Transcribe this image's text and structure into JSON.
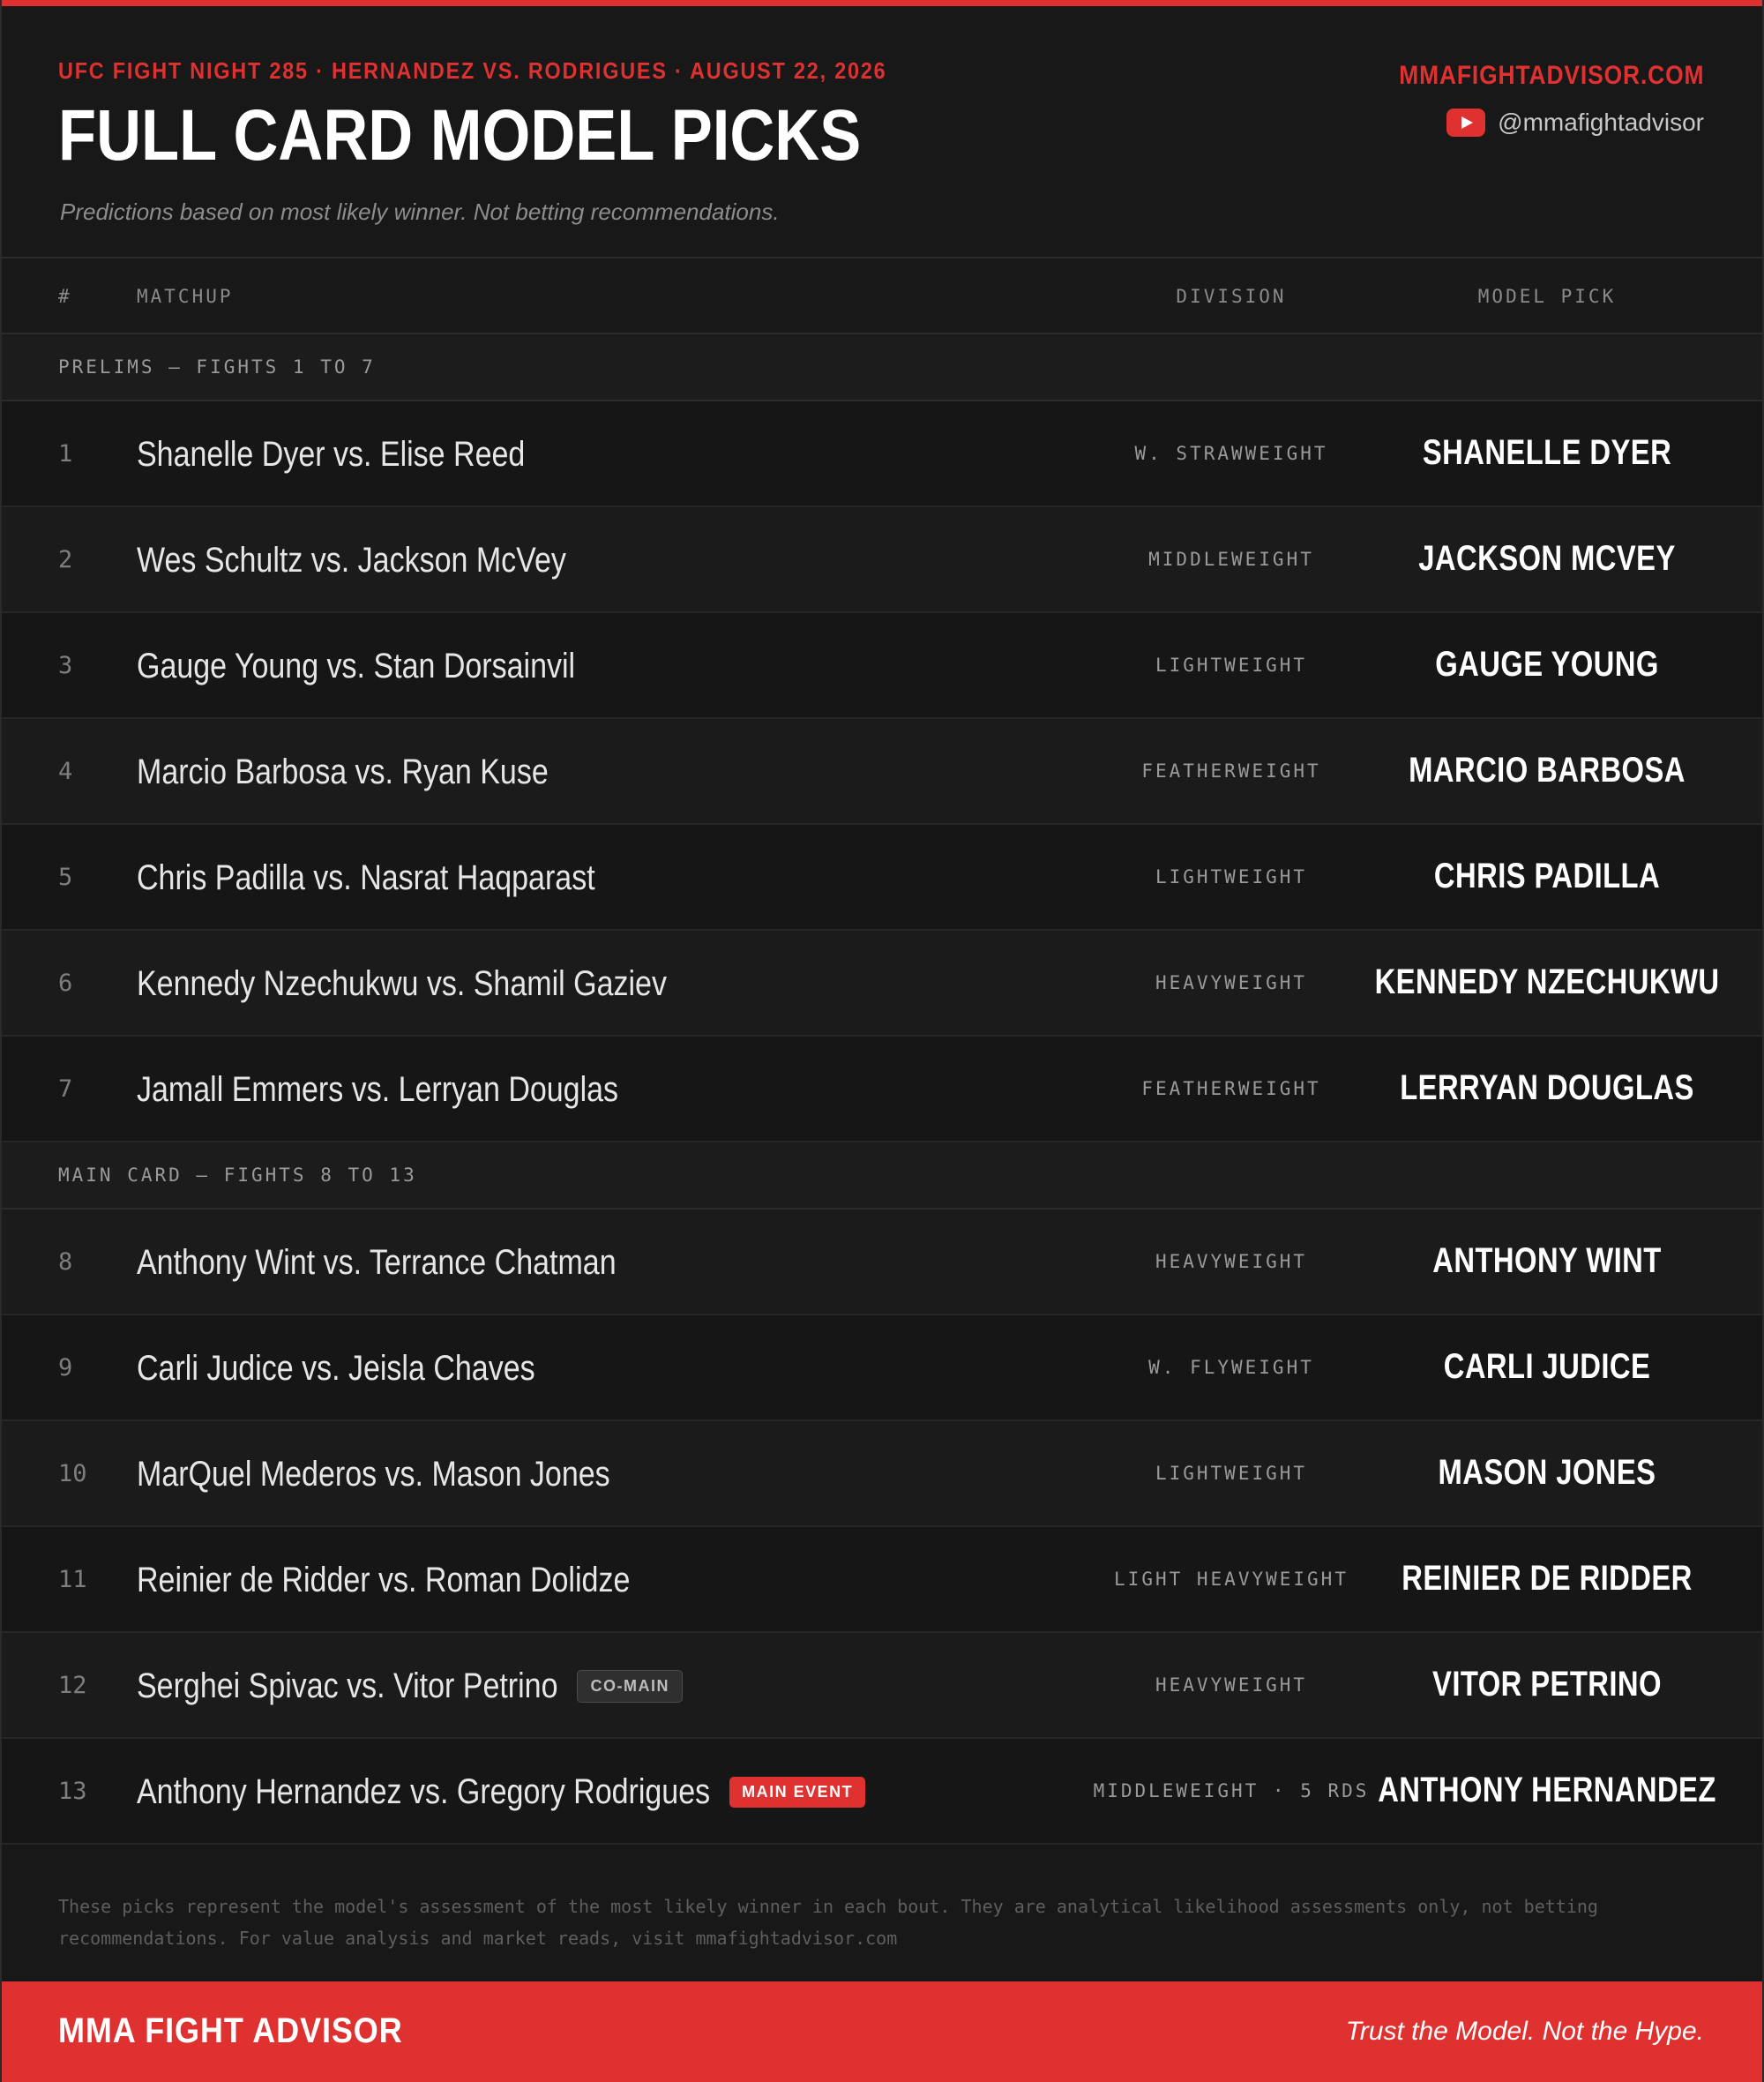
{
  "header": {
    "kicker": "UFC FIGHT NIGHT 285 · HERNANDEZ VS. RODRIGUES · AUGUST 22, 2026",
    "title": "FULL CARD MODEL PICKS",
    "subtitle": "Predictions based on most likely winner. Not betting recommendations.",
    "site": "MMAFIGHTADVISOR.COM",
    "handle": "@mmafightadvisor",
    "handle_icon": "youtube-icon"
  },
  "columns": {
    "num": "#",
    "matchup": "MATCHUP",
    "division": "DIVISION",
    "pick": "MODEL PICK"
  },
  "sections": [
    {
      "label": "PRELIMS — FIGHTS 1 TO 7",
      "fights": [
        {
          "num": "1",
          "matchup": "Shanelle Dyer vs. Elise Reed",
          "division": "W. STRAWWEIGHT",
          "pick": "SHANELLE DYER"
        },
        {
          "num": "2",
          "matchup": "Wes Schultz vs. Jackson McVey",
          "division": "MIDDLEWEIGHT",
          "pick": "JACKSON MCVEY"
        },
        {
          "num": "3",
          "matchup": "Gauge Young vs. Stan Dorsainvil",
          "division": "LIGHTWEIGHT",
          "pick": "GAUGE YOUNG"
        },
        {
          "num": "4",
          "matchup": "Marcio Barbosa vs. Ryan Kuse",
          "division": "FEATHERWEIGHT",
          "pick": "MARCIO BARBOSA"
        },
        {
          "num": "5",
          "matchup": "Chris Padilla vs. Nasrat Haqparast",
          "division": "LIGHTWEIGHT",
          "pick": "CHRIS PADILLA"
        },
        {
          "num": "6",
          "matchup": "Kennedy Nzechukwu vs. Shamil Gaziev",
          "division": "HEAVYWEIGHT",
          "pick": "KENNEDY NZECHUKWU"
        },
        {
          "num": "7",
          "matchup": "Jamall Emmers vs. Lerryan Douglas",
          "division": "FEATHERWEIGHT",
          "pick": "LERRYAN DOUGLAS"
        }
      ]
    },
    {
      "label": "MAIN CARD — FIGHTS 8 TO 13",
      "fights": [
        {
          "num": "8",
          "matchup": "Anthony Wint vs. Terrance Chatman",
          "division": "HEAVYWEIGHT",
          "pick": "ANTHONY WINT"
        },
        {
          "num": "9",
          "matchup": "Carli Judice vs. Jeisla Chaves",
          "division": "W. FLYWEIGHT",
          "pick": "CARLI JUDICE"
        },
        {
          "num": "10",
          "matchup": "MarQuel Mederos vs. Mason Jones",
          "division": "LIGHTWEIGHT",
          "pick": "MASON JONES"
        },
        {
          "num": "11",
          "matchup": "Reinier de Ridder vs. Roman Dolidze",
          "division": "LIGHT HEAVYWEIGHT",
          "pick": "REINIER DE RIDDER"
        },
        {
          "num": "12",
          "matchup": "Serghei Spivac vs. Vitor Petrino",
          "badge": "CO-MAIN",
          "badge_style": "co",
          "division": "HEAVYWEIGHT",
          "pick": "VITOR PETRINO"
        },
        {
          "num": "13",
          "matchup": "Anthony Hernandez vs. Gregory Rodrigues",
          "badge": "MAIN EVENT",
          "badge_style": "main",
          "division": "MIDDLEWEIGHT · 5 RDS",
          "pick": "ANTHONY HERNANDEZ"
        }
      ]
    }
  ],
  "disclaimer": "These picks represent the model's assessment of the most likely winner in each bout. They are analytical likelihood assessments only, not betting recommendations. For value analysis and market reads, visit mmafightadvisor.com",
  "footer": {
    "brand": "MMA FIGHT ADVISOR",
    "tagline": "Trust the Model. Not the Hype."
  },
  "colors": {
    "accent": "#e03131",
    "background": "#161616"
  }
}
